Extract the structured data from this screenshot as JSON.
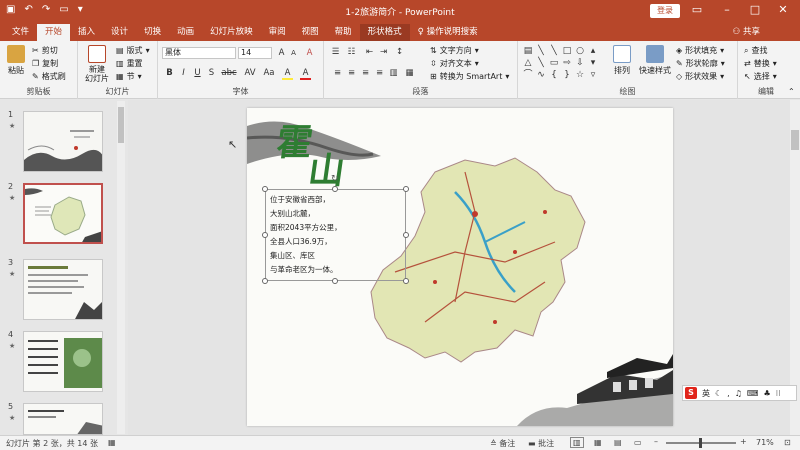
{
  "titlebar": {
    "title": "1-2旅游简介 - PowerPoint",
    "login_label": "登录",
    "qat_icons": [
      "save-icon",
      "undo-icon",
      "redo-icon",
      "present-icon",
      "customize-icon"
    ]
  },
  "tabs": [
    "文件",
    "开始",
    "插入",
    "设计",
    "切换",
    "动画",
    "幻灯片放映",
    "审阅",
    "视图",
    "帮助",
    "形状格式",
    "操作说明搜索"
  ],
  "active_tab": "开始",
  "share_label": "共享",
  "ribbon": {
    "clipboard": {
      "label": "剪贴板",
      "paste": "粘贴",
      "cut": "剪切",
      "copy": "复制",
      "painter": "格式刷"
    },
    "slides": {
      "label": "幻灯片",
      "new_slide": "新建\n幻灯片",
      "layout": "版式",
      "reset": "重置",
      "section": "节"
    },
    "font": {
      "label": "字体",
      "font_name": "黑体",
      "font_size": "14",
      "bold": "B",
      "italic": "I",
      "underline": "U",
      "shadow": "S",
      "strike": "abc",
      "spacing": "AV",
      "case": "Aa",
      "clear": "A",
      "increase": "A",
      "decrease": "A",
      "font_color": "A",
      "highlight": "A"
    },
    "paragraph": {
      "label": "段落",
      "text_direction": "文字方向",
      "align_text": "对齐文本",
      "smartart": "转换为 SmartArt"
    },
    "drawing": {
      "label": "绘图",
      "arrange": "排列",
      "quick_styles": "快速样式",
      "shape_fill": "形状填充",
      "shape_outline": "形状轮廓",
      "shape_effects": "形状效果"
    },
    "editing": {
      "label": "编辑",
      "find": "查找",
      "replace": "替换",
      "select": "选择"
    }
  },
  "slides": [
    {
      "num": "1",
      "star": "★"
    },
    {
      "num": "2",
      "star": "★"
    },
    {
      "num": "3",
      "star": "★"
    },
    {
      "num": "4",
      "star": "★"
    },
    {
      "num": "5",
      "star": "★"
    }
  ],
  "selected_slide": 2,
  "slide": {
    "title_char1": "霍",
    "title_char2": "山",
    "body_lines": [
      "位于安徽省西部，",
      "大别山北麓，",
      "面积2043平方公里，",
      "全县人口36.9万，",
      "集山区、库区",
      "与革命老区为一体。"
    ]
  },
  "status": {
    "slide_info": "幻灯片 第 2 张，共 14 张",
    "notes": "备注",
    "comments": "批注",
    "zoom": "71%"
  },
  "ime": {
    "logo": "S",
    "mode": "英"
  },
  "colors": {
    "accent": "#b7472a",
    "slide_title_green": "#2e7d32"
  }
}
